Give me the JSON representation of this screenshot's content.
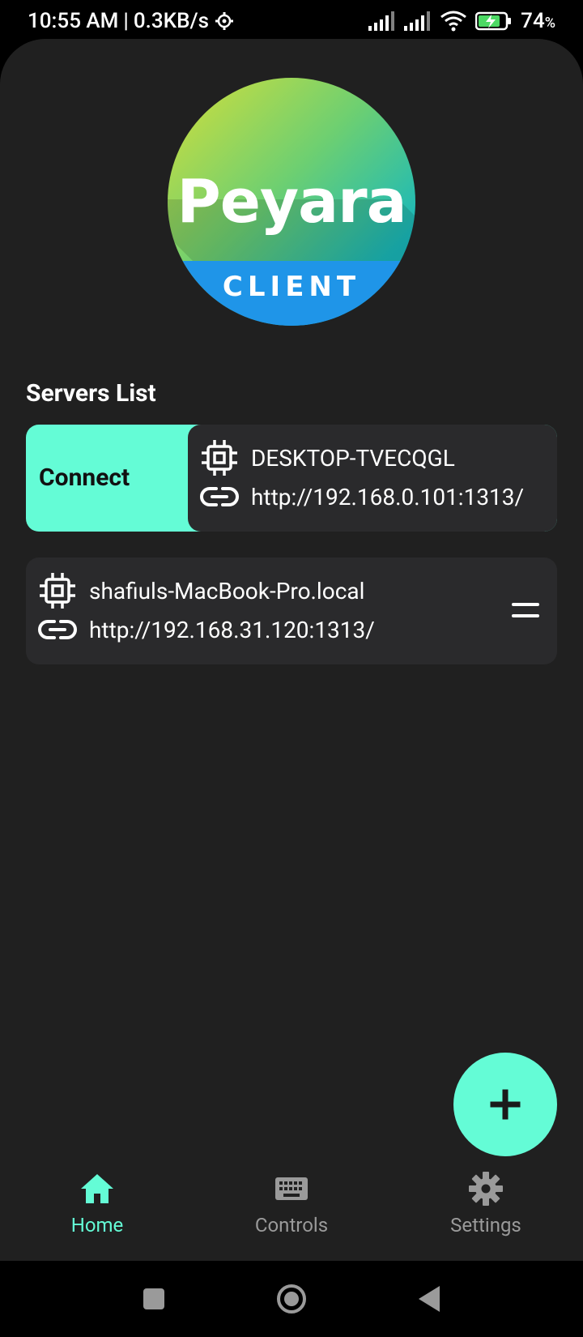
{
  "status_bar": {
    "time": "10:55 AM",
    "separator": "|",
    "speed": "0.3KB/s",
    "battery": "74",
    "battery_unit": "%"
  },
  "logo": {
    "word": "Peyara",
    "band": "CLIENT"
  },
  "servers": {
    "title": "Servers List",
    "connect_label": "Connect",
    "items": [
      {
        "name": "DESKTOP-TVECQGL",
        "url": "http://192.168.0.101:1313/"
      },
      {
        "name": "shafiuls-MacBook-Pro.local",
        "url": "http://192.168.31.120:1313/"
      }
    ]
  },
  "bottom_nav": {
    "home": "Home",
    "controls": "Controls",
    "settings": "Settings"
  },
  "colors": {
    "accent": "#64fcd6",
    "background": "#202020",
    "card": "#2a2a2c"
  }
}
